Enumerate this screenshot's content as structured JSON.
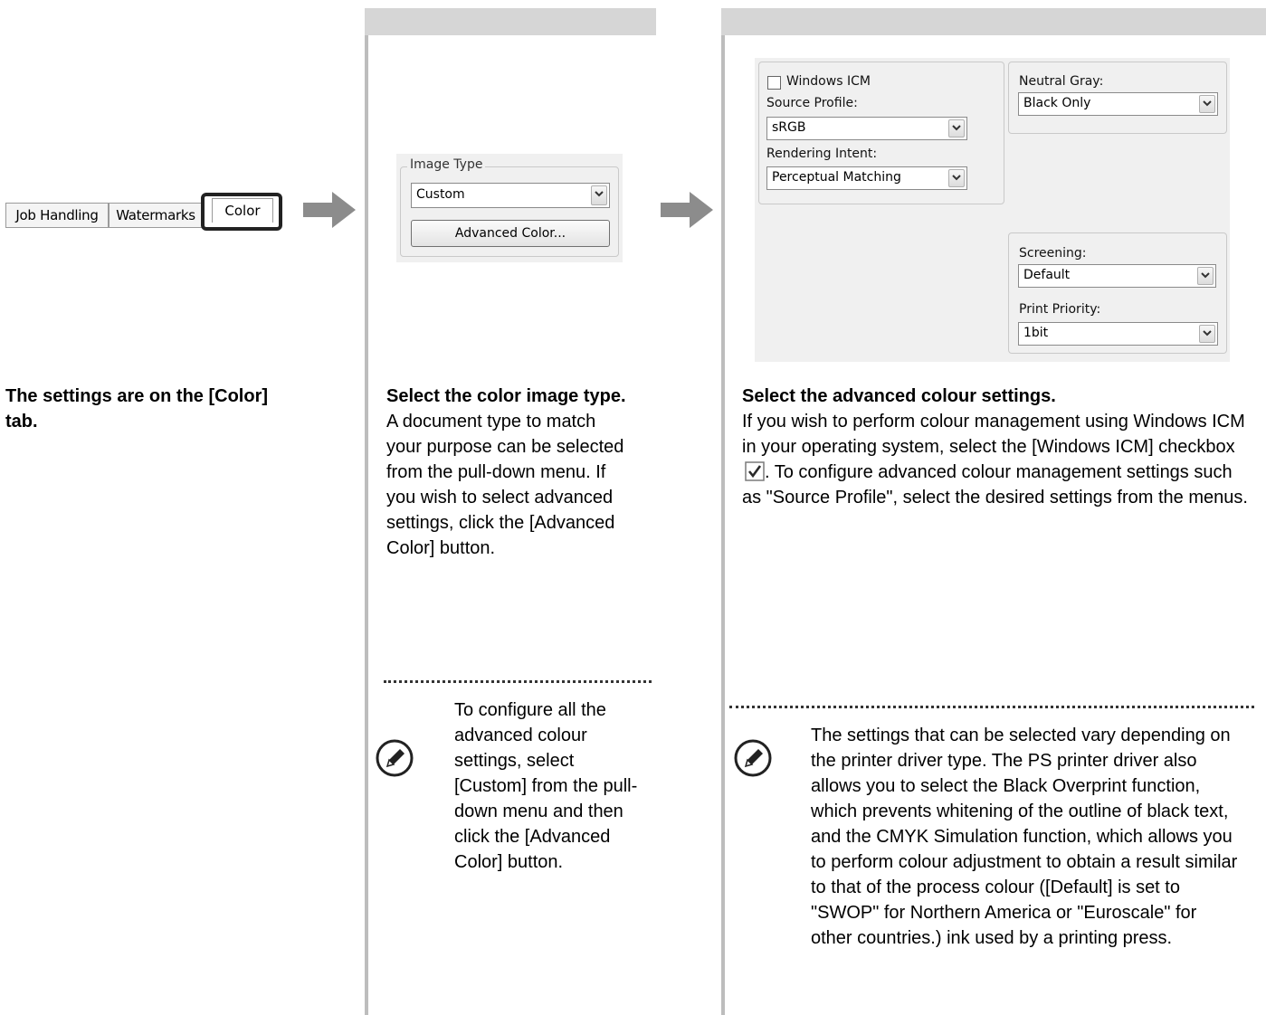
{
  "col1": {
    "tabs": [
      "Job Handling",
      "Watermarks",
      "Color"
    ],
    "caption": "The settings are on the [Color] tab."
  },
  "col2": {
    "group_title": "Image Type",
    "combo_value": "Custom",
    "button_label": "Advanced Color...",
    "heading": "Select the color image type.",
    "body": "A document type to match your purpose can be selected from the pull-down menu. If you wish to select advanced settings, click the [Advanced Color] button.",
    "note": "To configure all the advanced colour settings, select [Custom] from the pull-down menu and then click the [Advanced Color] button."
  },
  "col3": {
    "windows_icm_label": "Windows ICM",
    "source_profile_label": "Source Profile:",
    "source_profile_value": "sRGB",
    "rendering_intent_label": "Rendering Intent:",
    "rendering_intent_value": "Perceptual Matching",
    "neutral_gray_label": "Neutral Gray:",
    "neutral_gray_value": "Black Only",
    "screening_label": "Screening:",
    "screening_value": "Default",
    "print_priority_label": "Print Priority:",
    "print_priority_value": "1bit",
    "heading": "Select the advanced colour settings.",
    "body_before_icon": "If you wish to perform colour management using Windows ICM in your operating system, select the [Windows ICM] checkbox",
    "body_after_icon": ". To configure advanced colour management settings such as \"Source Profile\", select the desired settings from the menus.",
    "note": "The settings that can be selected vary depending on the printer driver type. The PS printer driver also allows you to select the Black Overprint function, which prevents whitening of the outline of black text, and the CMYK Simulation function, which allows you to perform colour adjustment to obtain a result similar to that of the process colour ([Default] is set to \"SWOP\" for Northern America or \"Euroscale\" for other countries.) ink used by a printing press."
  },
  "icons": {
    "arrow": "right-arrow-icon",
    "note": "pencil-note-icon",
    "checkmark": "checkbox-checked-icon"
  }
}
